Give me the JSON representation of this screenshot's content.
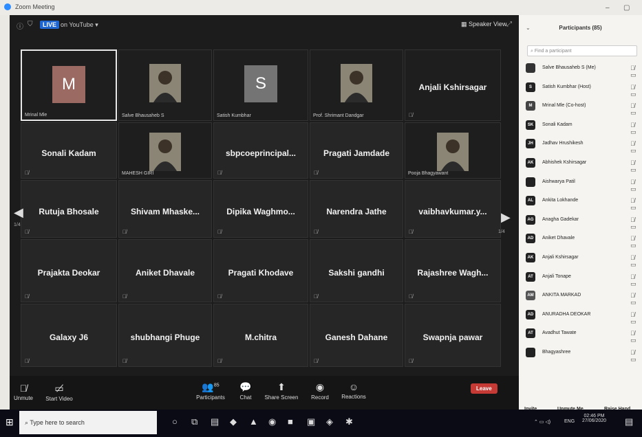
{
  "window": {
    "title": "Zoom Meeting"
  },
  "topbar": {
    "live": "LIVE",
    "on_youtube": "on YouTube ▾",
    "speaker_view": "Speaker View"
  },
  "pager": {
    "left": "1/4",
    "right": "1/4"
  },
  "tiles": [
    {
      "name": "M",
      "label": "Mrinal Mle",
      "kind": "avatar",
      "color": "#9b6a62",
      "active": true
    },
    {
      "name": "",
      "label": "Salve Bhausaheb S",
      "kind": "photo"
    },
    {
      "name": "S",
      "label": "Satish Kumbhar",
      "kind": "avatar",
      "color": "#747474"
    },
    {
      "name": "",
      "label": "Prof. Shrimant Dandgar",
      "kind": "photo"
    },
    {
      "name": "Anjali Kshirsagar",
      "label": "",
      "kind": "name"
    },
    {
      "name": "Sonali Kadam",
      "label": "",
      "kind": "name"
    },
    {
      "name": "",
      "label": "MAHESH GIRI",
      "kind": "photo"
    },
    {
      "name": "sbpcoeprincipal...",
      "label": "",
      "kind": "name"
    },
    {
      "name": "Pragati Jamdade",
      "label": "",
      "kind": "name"
    },
    {
      "name": "",
      "label": "Pooja Bhagyawant",
      "kind": "photo"
    },
    {
      "name": "Rutuja Bhosale",
      "label": "",
      "kind": "name"
    },
    {
      "name": "Shivam Mhaske...",
      "label": "",
      "kind": "name"
    },
    {
      "name": "Dipika Waghmo...",
      "label": "",
      "kind": "name"
    },
    {
      "name": "Narendra Jathe",
      "label": "",
      "kind": "name"
    },
    {
      "name": "vaibhavkumar.y...",
      "label": "",
      "kind": "name"
    },
    {
      "name": "Prajakta Deokar",
      "label": "",
      "kind": "name"
    },
    {
      "name": "Aniket Dhavale",
      "label": "",
      "kind": "name"
    },
    {
      "name": "Pragati Khodave",
      "label": "",
      "kind": "name"
    },
    {
      "name": "Sakshi gandhi",
      "label": "",
      "kind": "name"
    },
    {
      "name": "Rajashree Wagh...",
      "label": "",
      "kind": "name"
    },
    {
      "name": "Galaxy J6",
      "label": "",
      "kind": "name"
    },
    {
      "name": "shubhangi Phuge",
      "label": "",
      "kind": "name"
    },
    {
      "name": "M.chitra",
      "label": "",
      "kind": "name"
    },
    {
      "name": "Ganesh Dahane",
      "label": "",
      "kind": "name"
    },
    {
      "name": "Swapnja pawar",
      "label": "",
      "kind": "name"
    }
  ],
  "controls": {
    "unmute": "Unmute",
    "start_video": "Start Video",
    "participants": "Participants",
    "participants_count": "85",
    "chat": "Chat",
    "share_screen": "Share Screen",
    "record": "Record",
    "reactions": "Reactions",
    "leave": "Leave"
  },
  "panel": {
    "title": "Participants (85)",
    "search_placeholder": "Find a participant",
    "participants": [
      {
        "initials": "",
        "name": "Salve Bhausaheb S (Me)",
        "color": "#333333"
      },
      {
        "initials": "S",
        "name": "Satish Kumbhar (Host)",
        "color": "#222222"
      },
      {
        "initials": "M",
        "name": "Mrinal Mle (Co-host)",
        "color": "#444444"
      },
      {
        "initials": "SK",
        "name": "Sonali Kadam",
        "color": "#222222"
      },
      {
        "initials": "JH",
        "name": "Jadhav Hrushikesh",
        "color": "#222222"
      },
      {
        "initials": "AK",
        "name": "Abhishek Kshirsagar",
        "color": "#222222"
      },
      {
        "initials": "",
        "name": "Aishwarya Patil",
        "color": "#222222"
      },
      {
        "initials": "AL",
        "name": "Ankita Lokhande",
        "color": "#222222"
      },
      {
        "initials": "AG",
        "name": "Anagha Gadekar",
        "color": "#222222"
      },
      {
        "initials": "AD",
        "name": "Aniket Dhavale",
        "color": "#222222"
      },
      {
        "initials": "AK",
        "name": "Anjali Kshirsagar",
        "color": "#222222"
      },
      {
        "initials": "AT",
        "name": "Anjali Tonape",
        "color": "#222222"
      },
      {
        "initials": "AM",
        "name": "ANKITA MARKAD",
        "color": "#555555"
      },
      {
        "initials": "AD",
        "name": "ANURADHA DEOKAR",
        "color": "#222222"
      },
      {
        "initials": "AT",
        "name": "Avadhut Tawate",
        "color": "#222222"
      },
      {
        "initials": "",
        "name": "Bhagyashree",
        "color": "#222222"
      }
    ],
    "invite": "Invite",
    "unmute_me": "Unmute Me",
    "raise_hand": "Raise Hand"
  },
  "taskbar": {
    "search": "Type here to search",
    "time": "02:46 PM",
    "date": "27/06/2020",
    "lang": "ENG"
  }
}
